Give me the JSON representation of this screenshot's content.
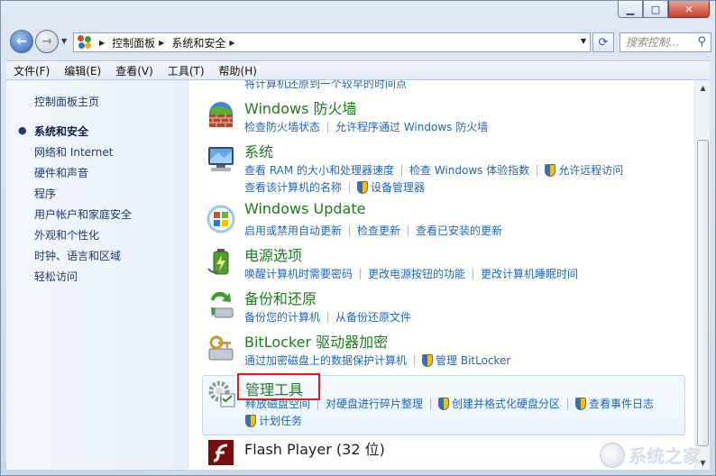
{
  "window": {
    "caption": {
      "minimize": "▁",
      "maximize": "□",
      "close": "✕"
    }
  },
  "address": {
    "crumbs": [
      "控制面板",
      "系统和安全"
    ],
    "search_placeholder": "搜索控制..."
  },
  "menubar": [
    "文件(F)",
    "编辑(E)",
    "查看(V)",
    "工具(T)",
    "帮助(H)"
  ],
  "sidebar": {
    "home": "控制面板主页",
    "items": [
      "系统和安全",
      "网络和 Internet",
      "硬件和声音",
      "程序",
      "用户帐户和家庭安全",
      "外观和个性化",
      "时钟、语言和区域",
      "轻松访问"
    ],
    "active_index": 0
  },
  "main": {
    "cut_text": "将计算机还原到一个较早的时间点",
    "categories": [
      {
        "title": "Windows 防火墙",
        "icon": "firewall-icon",
        "rows": [
          [
            {
              "text": "检查防火墙状态"
            },
            {
              "text": "允许程序通过 Windows 防火墙"
            }
          ]
        ]
      },
      {
        "title": "系统",
        "icon": "system-icon",
        "rows": [
          [
            {
              "text": "查看 RAM 的大小和处理器速度"
            },
            {
              "text": "检查 Windows 体验指数"
            },
            {
              "text": "允许远程访问",
              "shield": true
            }
          ],
          [
            {
              "text": "查看该计算机的名称"
            },
            {
              "text": "设备管理器",
              "shield": true
            }
          ]
        ]
      },
      {
        "title": "Windows Update",
        "icon": "windows-update-icon",
        "rows": [
          [
            {
              "text": "启用或禁用自动更新"
            },
            {
              "text": "检查更新"
            },
            {
              "text": "查看已安装的更新"
            }
          ]
        ]
      },
      {
        "title": "电源选项",
        "icon": "power-options-icon",
        "rows": [
          [
            {
              "text": "唤醒计算机时需要密码"
            },
            {
              "text": "更改电源按钮的功能"
            },
            {
              "text": "更改计算机睡眠时间"
            }
          ]
        ]
      },
      {
        "title": "备份和还原",
        "icon": "backup-restore-icon",
        "rows": [
          [
            {
              "text": "备份您的计算机"
            },
            {
              "text": "从备份还原文件"
            }
          ]
        ]
      },
      {
        "title": "BitLocker 驱动器加密",
        "icon": "bitlocker-icon",
        "rows": [
          [
            {
              "text": "通过加密磁盘上的数据保护计算机",
              "shield": true
            },
            {
              "text": "管理 BitLocker",
              "shield": true
            }
          ]
        ]
      },
      {
        "title": "管理工具",
        "icon": "admin-tools-icon",
        "highlighted": true,
        "rows": [
          [
            {
              "text": "释放磁盘空间"
            },
            {
              "text": "对硬盘进行碎片整理"
            },
            {
              "text": "创建并格式化硬盘分区",
              "shield": true
            },
            {
              "text": "查看事件日志",
              "shield": true
            }
          ],
          [
            {
              "text": "计划任务",
              "shield": true
            }
          ]
        ]
      },
      {
        "title": "Flash Player (32 位)",
        "icon": "flash-player-icon",
        "rows": []
      }
    ]
  },
  "watermark": {
    "text": "系统之家"
  },
  "colors": {
    "title_green": "#1e7b1e",
    "link_blue": "#2466b8",
    "highlight_red": "#e11a1a"
  }
}
